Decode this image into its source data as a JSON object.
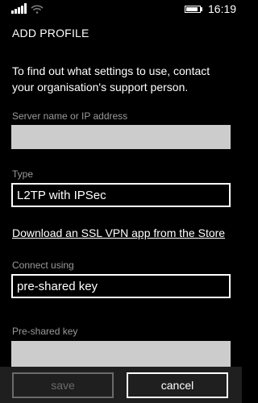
{
  "status_bar": {
    "time": "16:19",
    "signal_icon": "signal-bars-icon",
    "wifi_icon": "wifi-icon",
    "battery_icon": "battery-icon",
    "battery_level": 0.9
  },
  "header": {
    "title": "ADD PROFILE"
  },
  "intro_text": "To find out what settings to use, contact your organisation's support person.",
  "fields": {
    "server": {
      "label": "Server name or IP address",
      "value": ""
    },
    "type": {
      "label": "Type",
      "value": "L2TP with IPSec"
    },
    "store_link": "Download an SSL VPN app from the Store",
    "connect_using": {
      "label": "Connect using",
      "value": "pre-shared key"
    },
    "pre_shared_key": {
      "label": "Pre-shared key",
      "value": ""
    }
  },
  "app_bar": {
    "save_label": "save",
    "cancel_label": "cancel"
  },
  "colors": {
    "background": "#000000",
    "text": "#ffffff",
    "label": "#9a9a9a",
    "textbox": "#cccccc",
    "app_bar": "#1f1f1f",
    "disabled": "#6a6a6a"
  }
}
